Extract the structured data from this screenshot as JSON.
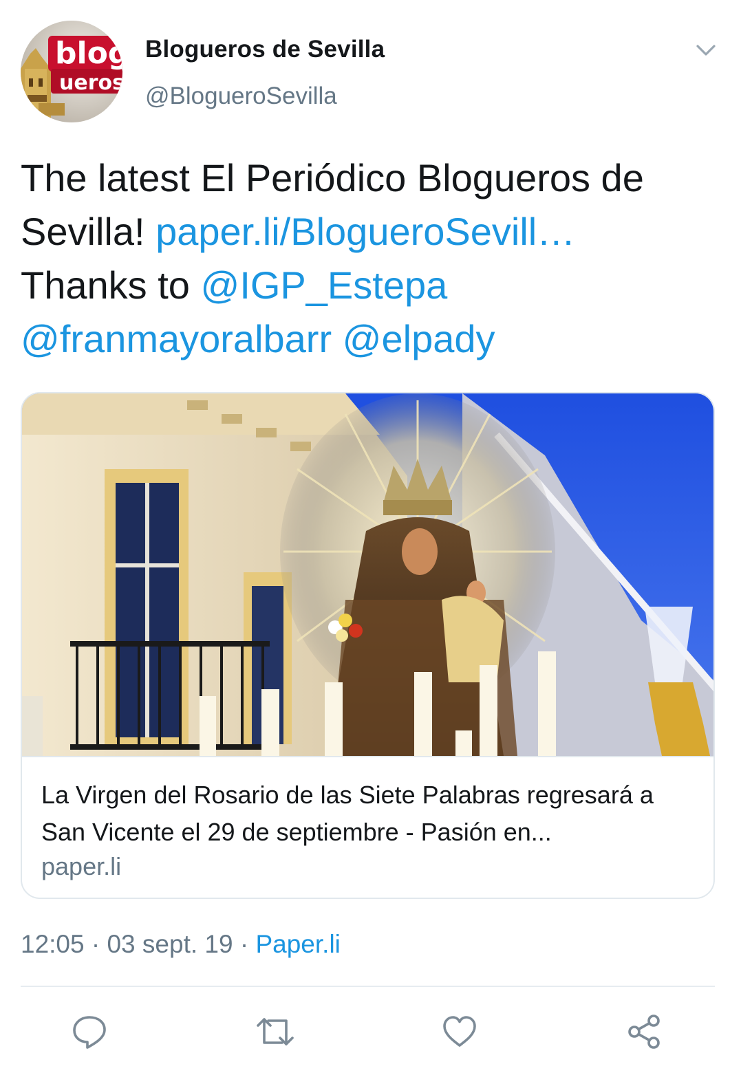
{
  "author": {
    "display_name": "Blogueros de Sevilla",
    "handle": "@BlogueroSevilla",
    "avatar_icon": "blogueros-logo-avatar"
  },
  "menu": {
    "icon": "chevron-down-icon"
  },
  "tweet": {
    "text_1": "The latest El Periódico Blogueros de Sevilla!",
    "link": "paper.li/BlogueroSevill…",
    "text_2": "Thanks to",
    "mention_1": "@IGP_Estepa",
    "mention_2": "@franmayoralbarr",
    "mention_3": "@elpady"
  },
  "card": {
    "title": "La Virgen del Rosario de las Siete Palabras regresará a San Vicente el 29 de septiembre - Pasión en...",
    "domain": "paper.li"
  },
  "meta": {
    "time": "12:05",
    "sep_1": " · ",
    "date": "03 sept. 19",
    "sep_2": " · ",
    "source": "Paper.li"
  },
  "actions": [
    {
      "icon": "reply-icon"
    },
    {
      "icon": "retweet-icon"
    },
    {
      "icon": "like-icon"
    },
    {
      "icon": "share-icon"
    }
  ],
  "colors": {
    "link": "#1b95e0",
    "secondary_text": "#657786",
    "primary_text": "#14171a",
    "border": "#e1e8ed"
  }
}
